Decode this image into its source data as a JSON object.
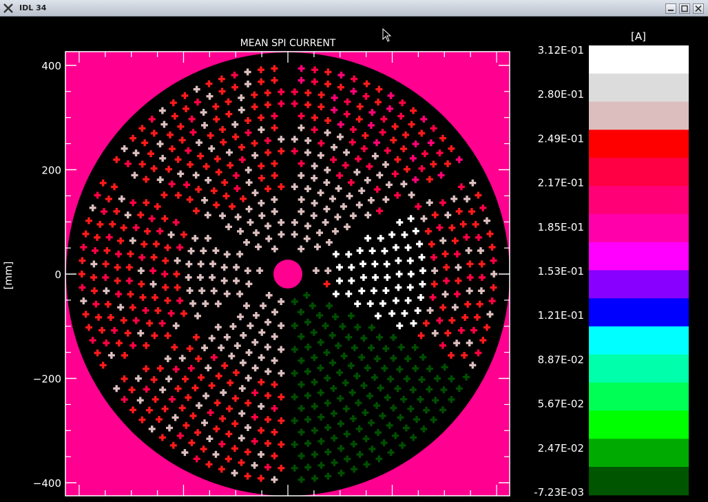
{
  "window": {
    "title": "IDL 34",
    "buttons": {
      "minimize": "minimize",
      "maximize": "maximize",
      "close": "close"
    }
  },
  "plot": {
    "title": "MEAN SPI CURRENT",
    "ylabel": "[mm]",
    "yticks": [
      "400",
      "200",
      "0",
      "−200",
      "−400"
    ],
    "ytick_values": [
      400,
      200,
      0,
      -200,
      -400
    ],
    "background_color": "#ff0090",
    "disk_color": "#000000",
    "hub_color": "#ff0090"
  },
  "colorbar": {
    "unit": "[A]",
    "labels": [
      "3.12E-01",
      "2.80E-01",
      "2.49E-01",
      "2.17E-01",
      "1.85E-01",
      "1.53E-01",
      "1.21E-01",
      "8.87E-02",
      "5.67E-02",
      "2.47E-02",
      "-7.23E-03"
    ],
    "colors": [
      "#ffffff",
      "#dcdcdc",
      "#dcbebe",
      "#ff0000",
      "#ff0044",
      "#ff0077",
      "#ff00aa",
      "#ff00ff",
      "#8800ff",
      "#0000ff",
      "#00ffff",
      "#00ffaa",
      "#00ff55",
      "#00ff00",
      "#00aa00",
      "#005500"
    ]
  },
  "chart_data": {
    "type": "heatmap",
    "title": "MEAN SPI CURRENT",
    "ylabel": "[mm]",
    "ylim": [
      -400,
      400
    ],
    "yticks": [
      400,
      200,
      0,
      -200,
      -400
    ],
    "colorbar_unit": "[A]",
    "colorbar_range": [
      -0.00723,
      0.312
    ],
    "colorbar_ticks": [
      0.312,
      0.28,
      0.249,
      0.217,
      0.185,
      0.153,
      0.121,
      0.0887,
      0.0567,
      0.0247,
      -0.00723
    ],
    "colorbar_levels": 16,
    "sectors": [
      {
        "from_deg": -90,
        "to_deg": -28,
        "level": "dark-green",
        "color": "#005500"
      },
      {
        "from_deg": -28,
        "to_deg": 30,
        "level": "white",
        "color": "#ffffff"
      },
      {
        "from_deg": 30,
        "to_deg": 90,
        "level": "light-pink",
        "color": "#dcbebe"
      },
      {
        "from_deg": 90,
        "to_deg": 150,
        "level": "red/light-pink mix",
        "color": "#ff0000"
      },
      {
        "from_deg": 150,
        "to_deg": 210,
        "level": "light-pink inner / red outer",
        "color": "#dcbebe"
      },
      {
        "from_deg": 210,
        "to_deg": 270,
        "level": "red/light-pink mix",
        "color": "#ff0000"
      }
    ]
  }
}
